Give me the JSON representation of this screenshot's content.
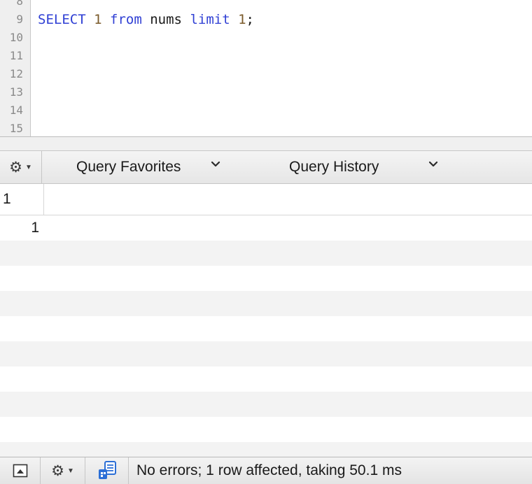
{
  "editor": {
    "line_numbers": [
      "8",
      "9",
      "10",
      "11",
      "12",
      "13",
      "14",
      "15"
    ],
    "code": {
      "kw1": "SELECT",
      "num1": "1",
      "kw2": "from",
      "table": "nums",
      "kw3": "limit",
      "num2": "1",
      "end": ";"
    }
  },
  "query_bar": {
    "gear_icon": "gear-icon",
    "favorites_label": "Query Favorites",
    "history_label": "Query History"
  },
  "results": {
    "columns": [
      "1"
    ],
    "rows": [
      [
        "1"
      ]
    ]
  },
  "status_bar": {
    "message": "No errors; 1 row affected, taking 50.1 ms"
  },
  "colors": {
    "keyword": "#2f3fd4",
    "number": "#7a5a2a",
    "alt_row": "#f3f3f3"
  }
}
